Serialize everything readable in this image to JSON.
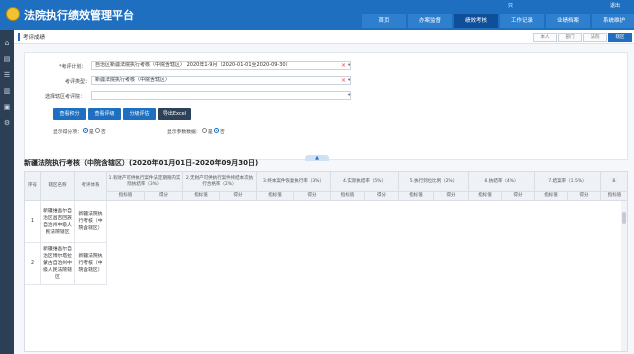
{
  "header": {
    "app_title": "法院执行绩效管理平台",
    "user_icon": "user-icon",
    "user_icon_glyph": "只",
    "user_link": "退出",
    "nav": [
      {
        "label": "首页",
        "active": false
      },
      {
        "label": "办案监督",
        "active": false
      },
      {
        "label": "绩效考核",
        "active": true
      },
      {
        "label": "工作记录",
        "active": false
      },
      {
        "label": "业绩档案",
        "active": false
      },
      {
        "label": "系统维护",
        "active": false
      }
    ]
  },
  "sidebar": {
    "icons": [
      {
        "name": "home-icon",
        "glyph": "⌂"
      },
      {
        "name": "document-icon",
        "glyph": "▤"
      },
      {
        "name": "list-icon",
        "glyph": "☰"
      },
      {
        "name": "chart-icon",
        "glyph": "▥"
      },
      {
        "name": "folder-icon",
        "glyph": "▣"
      },
      {
        "name": "settings-icon",
        "glyph": "⚙"
      }
    ]
  },
  "breadcrumb": {
    "label": "考评成绩",
    "view_tabs": [
      {
        "label": "本人",
        "active": false
      },
      {
        "label": "部门",
        "active": false
      },
      {
        "label": "法院",
        "active": false
      },
      {
        "label": "辖区",
        "active": true
      }
    ]
  },
  "filters": {
    "plan_label": "*考评计划：",
    "plan_value": "自治区新疆法院执行考核（中院含辖区） 2020年1-9月（2020-01-01至2020-09-30）",
    "category_label": "考评类型：",
    "category_value": "新疆法院执行考核（中院含辖区）",
    "court_label": "选择辖区考评院：",
    "court_value": "",
    "clear_symbol": "×",
    "caret_symbol": "▾",
    "buttons": {
      "query": "查看积分",
      "query_score": "查看评级",
      "query_rank": "分级评估",
      "export": "导出Excel"
    },
    "show_indicator_label": "显示得分项：",
    "show_indicator_options": [
      "是",
      "否"
    ],
    "show_indicator_selected": "是",
    "show_param_label": "显示参数数据：",
    "show_param_options": [
      "是",
      "否"
    ],
    "show_param_selected": "否",
    "collapse_symbol": "▲"
  },
  "report": {
    "title": "新疆法院执行考核（中院含辖区）(2020年01月01日-2020年09月30日)"
  },
  "table": {
    "col_seq": "序号",
    "col_org": "辖区名称",
    "col_type": "考评体系",
    "indicator_groups": [
      "1.有财产可供执行案件法定期限内实际执结率（3%）",
      "2.无财产可供执行案件终结本次执行合格率（2%）",
      "3.终本案件恢复执行率（3%）",
      "4.实际执结率（5%）",
      "5.执行到位比例（2%）",
      "6.执结率（4%）",
      "7.结案率（1.5%）",
      "8."
    ],
    "sub_headers": [
      "指标值",
      "得分"
    ],
    "rows": [
      {
        "seq": "1",
        "org": "新疆维吾尔自治区昌吉回族自治州中级人民法院辖区",
        "type": "新疆法院执行考核（中院含辖区）"
      },
      {
        "seq": "2",
        "org": "新疆维吾尔自治区博尔塔拉蒙古自治州中级人民法院辖区",
        "type": "新疆法院执行考核（中院含辖区）"
      }
    ]
  },
  "colors": {
    "brand": "#1f6fc0",
    "nav_active": "#0f4f99",
    "sidebar": "#2d3f55",
    "clear": "#e04040"
  }
}
